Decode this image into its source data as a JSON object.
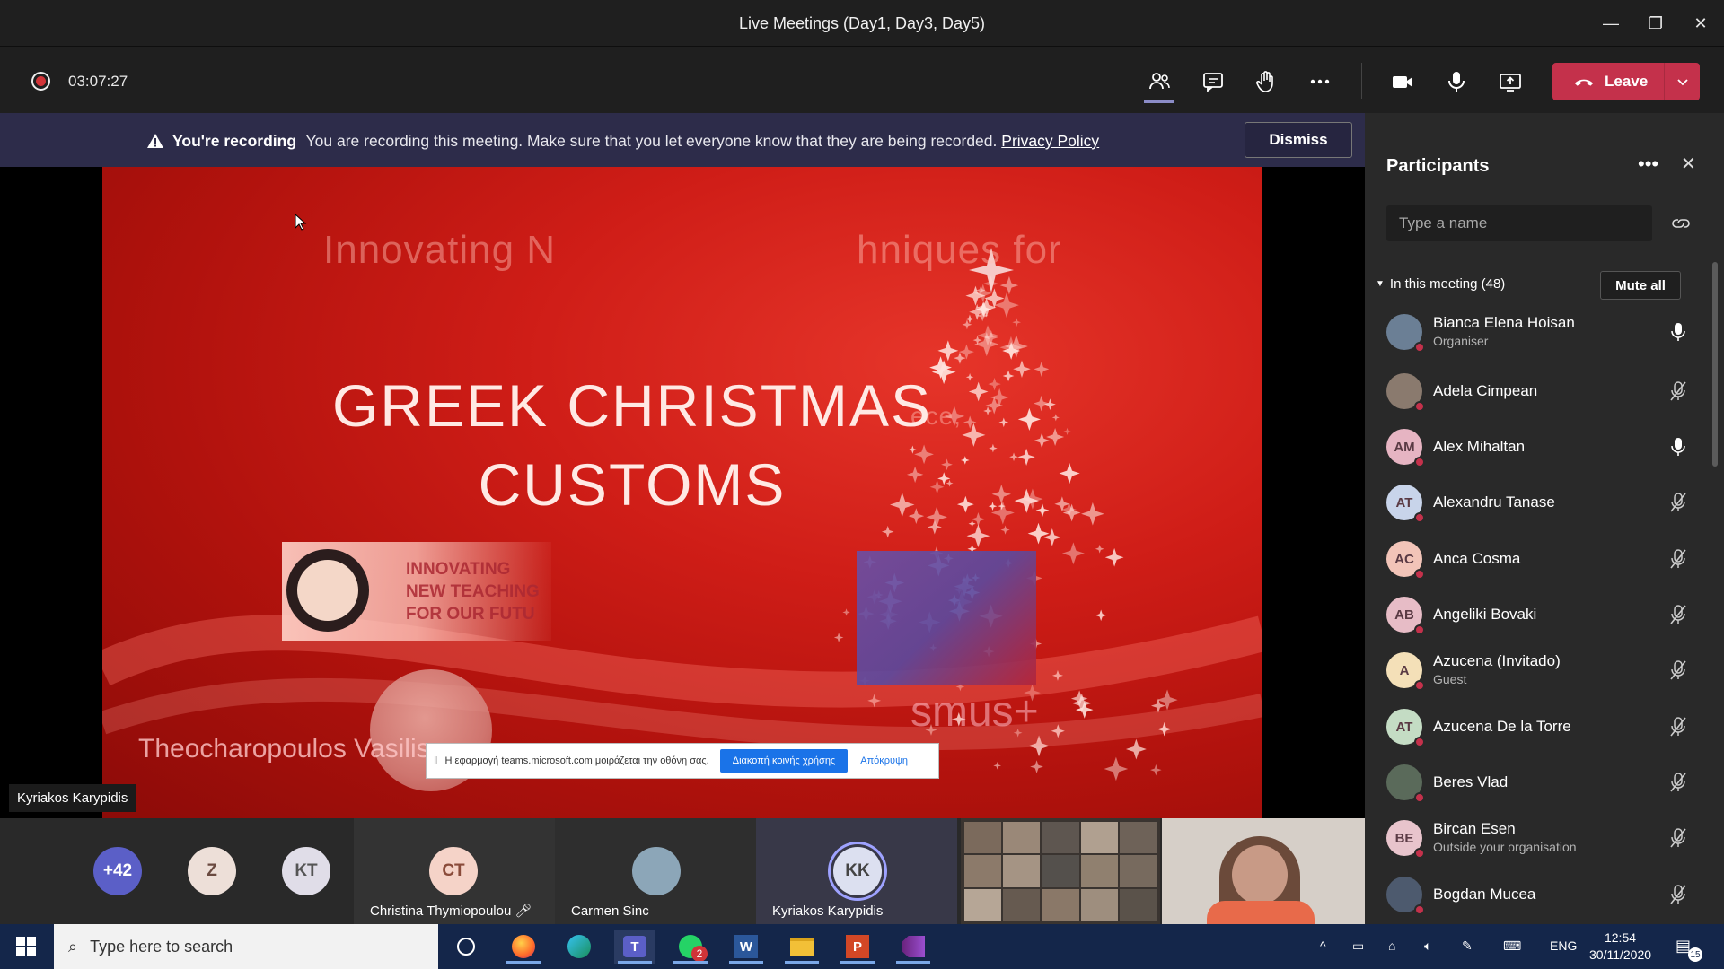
{
  "window": {
    "title": "Live Meetings (Day1, Day3, Day5)"
  },
  "toolbar": {
    "timer": "03:07:27",
    "leave_label": "Leave"
  },
  "banner": {
    "heading": "You're recording",
    "message": "You are recording this meeting. Make sure that you let everyone know that they are being recorded.",
    "link": "Privacy Policy",
    "dismiss": "Dismiss"
  },
  "slide": {
    "faint_top_left": "Innovating N",
    "faint_top_right": "hniques for",
    "title_line1": "GREEK CHRISTMAS",
    "title_line2": "CUSTOMS",
    "faint_mid": "ece,",
    "logo_text_1": "INNOVATING",
    "logo_text_2": "NEW TEACHING",
    "logo_text_3": "FOR OUR FUTU",
    "erasmus": "smus+",
    "author": "Theocharopoulos Vasilis,",
    "share_message": "Η εφαρμογή teams.microsoft.com μοιράζεται την οθόνη σας.",
    "share_stop": "Διακοπή κοινής χρήσης",
    "share_hide": "Απόκρυψη",
    "speaker": "Kyriakos Karypidis"
  },
  "strip": {
    "overflow": "+42",
    "avatars": [
      "Z",
      "KT"
    ],
    "tiles": [
      {
        "initials": "CT",
        "name": "Christina Thymiopoulou"
      },
      {
        "initials": "",
        "name": "Carmen Sinc"
      },
      {
        "initials": "KK",
        "name": "Kyriakos Karypidis"
      }
    ]
  },
  "panel": {
    "title": "Participants",
    "search_placeholder": "Type a name",
    "section": "In this meeting (48)",
    "mute_all": "Mute all",
    "participants": [
      {
        "name": "Bianca Elena Hoisan",
        "role": "Organiser",
        "initials": "",
        "color": "#6b7f95",
        "mic": "on"
      },
      {
        "name": "Adela Cimpean",
        "role": "",
        "initials": "",
        "color": "#8a7a6e",
        "mic": "off"
      },
      {
        "name": "Alex Mihaltan",
        "role": "",
        "initials": "AM",
        "color": "#e6b4c2",
        "mic": "on"
      },
      {
        "name": "Alexandru Tanase",
        "role": "",
        "initials": "AT",
        "color": "#c8d4ea",
        "mic": "off"
      },
      {
        "name": "Anca Cosma",
        "role": "",
        "initials": "AC",
        "color": "#f2c4b8",
        "mic": "off"
      },
      {
        "name": "Angeliki Bovaki",
        "role": "",
        "initials": "AB",
        "color": "#e7bcc6",
        "mic": "off"
      },
      {
        "name": "Azucena (Invitado)",
        "role": "Guest",
        "initials": "A",
        "color": "#f4e0b8",
        "mic": "off"
      },
      {
        "name": "Azucena De la Torre",
        "role": "",
        "initials": "AT",
        "color": "#c4dcc4",
        "mic": "off"
      },
      {
        "name": "Beres Vlad",
        "role": "",
        "initials": "",
        "color": "#5a6a5a",
        "mic": "off"
      },
      {
        "name": "Bircan Esen",
        "role": "Outside your organisation",
        "initials": "BE",
        "color": "#e8c4cc",
        "mic": "off"
      },
      {
        "name": "Bogdan Mucea",
        "role": "",
        "initials": "",
        "color": "#4d5a6e",
        "mic": "off"
      }
    ]
  },
  "taskbar": {
    "search_placeholder": "Type here to search",
    "whatsapp_badge": "2",
    "lang": "ENG",
    "time": "12:54",
    "date": "30/11/2020",
    "notifications": "15"
  }
}
